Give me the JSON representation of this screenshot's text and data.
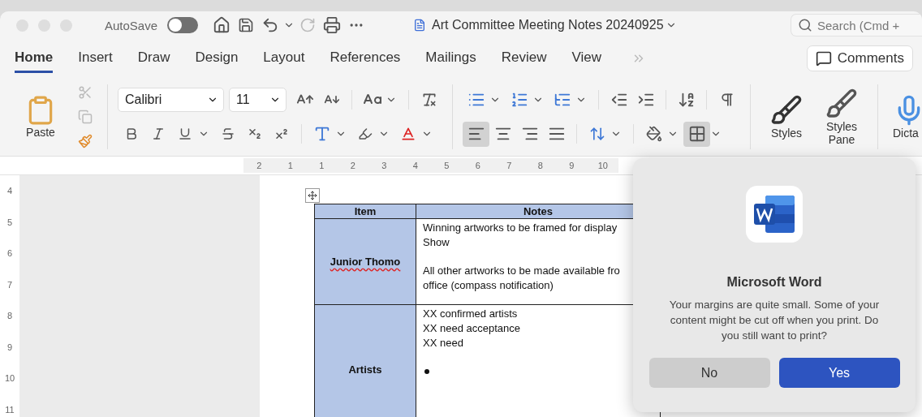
{
  "window": {
    "title": "Art Committee Meeting Notes 20240925",
    "autosave": {
      "label": "AutoSave",
      "on": false
    },
    "redo_disabled": true,
    "search": {
      "placeholder": "Search (Cmd +"
    }
  },
  "tabs": [
    {
      "label": "Home",
      "selected": true
    },
    {
      "label": "Insert",
      "selected": false
    },
    {
      "label": "Draw",
      "selected": false
    },
    {
      "label": "Design",
      "selected": false
    },
    {
      "label": "Layout",
      "selected": false
    },
    {
      "label": "References",
      "selected": false
    },
    {
      "label": "Mailings",
      "selected": false
    },
    {
      "label": "Review",
      "selected": false
    },
    {
      "label": "View",
      "selected": false
    }
  ],
  "comments_button": "Comments",
  "ribbon": {
    "paste_label": "Paste",
    "cut_disabled": true,
    "copy_disabled": true,
    "font": "Calibri",
    "font_size": "11",
    "alignment": [
      {
        "selected": true
      },
      {
        "selected": false
      },
      {
        "selected": false
      },
      {
        "selected": false
      }
    ],
    "borders_selected": true,
    "styles_label": "Styles",
    "styles_pane_label": "Styles Pane",
    "dictate_label": "Dicta"
  },
  "ruler": {
    "horizontal": [
      "2",
      "1",
      "1",
      "2",
      "3",
      "4",
      "5",
      "6",
      "7",
      "8",
      "9",
      "10"
    ],
    "vertical": [
      "4",
      "5",
      "6",
      "7",
      "8",
      "9",
      "10",
      "11"
    ]
  },
  "table": {
    "columns": [
      "Item",
      "Notes"
    ],
    "rows": [
      {
        "item": "Junior Thomo",
        "misspelled": true,
        "lines": [
          {
            "kind": "text",
            "text": "Winning artworks to be framed for display"
          },
          {
            "kind": "text",
            "text": "Show"
          },
          {
            "kind": "gap"
          },
          {
            "kind": "text",
            "text": "All other artworks to be made available fro"
          },
          {
            "kind": "text",
            "text": "office (compass notification)"
          }
        ]
      },
      {
        "item": "Artists",
        "misspelled": false,
        "lines": [
          {
            "kind": "text",
            "text": "XX confirmed artists"
          },
          {
            "kind": "text",
            "text": "XX need acceptance"
          },
          {
            "kind": "text",
            "text": "XX need"
          },
          {
            "kind": "gap"
          },
          {
            "kind": "bullet"
          }
        ]
      }
    ]
  },
  "dialog": {
    "title": "Microsoft Word",
    "message": "Your margins are quite small. Some of your content might be cut off when you print. Do you still want to print?",
    "buttons": [
      {
        "label": "No",
        "kind": "default"
      },
      {
        "label": "Yes",
        "kind": "primary"
      }
    ]
  }
}
